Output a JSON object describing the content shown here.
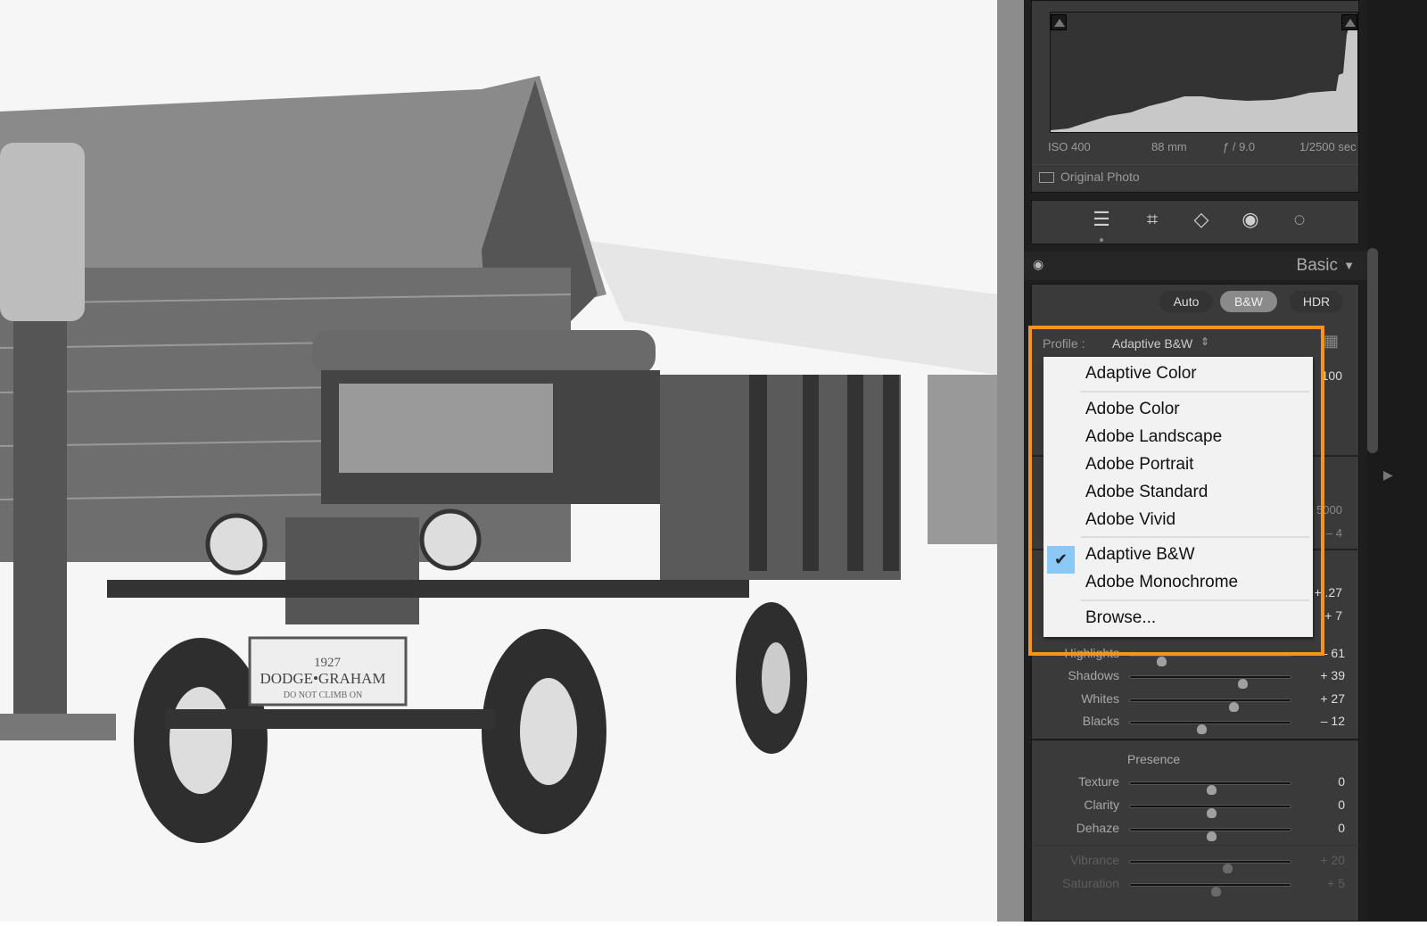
{
  "histogram": {
    "iso": "ISO 400",
    "focal": "88 mm",
    "aperture": "ƒ / 9.0",
    "shutter": "1/2500 sec",
    "original_photo_label": "Original Photo"
  },
  "tools": [
    "edit-sliders-icon",
    "crop-icon",
    "healing-eraser-icon",
    "red-eye-icon",
    "masking-icon"
  ],
  "basic": {
    "title": "Basic",
    "auto": "Auto",
    "bw": "B&W",
    "hdr": "HDR"
  },
  "profile": {
    "label": "Profile :",
    "value": "Adaptive B&W"
  },
  "profile_menu": {
    "items": [
      "Adaptive Color",
      "Adobe Color",
      "Adobe Landscape",
      "Adobe Portrait",
      "Adobe Standard",
      "Adobe Vivid",
      "Adaptive B&W",
      "Adobe Monochrome",
      "Browse..."
    ],
    "selected": "Adaptive B&W"
  },
  "hidden_values": {
    "amount": "100",
    "temp": "5000",
    "tint": "– 4",
    "exposure": "+ .27",
    "contrast": "+ 7"
  },
  "sliders": [
    {
      "label": "Highlights",
      "value": "– 61",
      "num": -61
    },
    {
      "label": "Shadows",
      "value": "+ 39",
      "num": 39
    },
    {
      "label": "Whites",
      "value": "+ 27",
      "num": 27
    },
    {
      "label": "Blacks",
      "value": "– 12",
      "num": -12
    }
  ],
  "presence": {
    "title": "Presence",
    "sliders": [
      {
        "label": "Texture",
        "value": "0",
        "num": 0
      },
      {
        "label": "Clarity",
        "value": "0",
        "num": 0
      },
      {
        "label": "Dehaze",
        "value": "0",
        "num": 0
      },
      {
        "label": "Vibrance",
        "value": "+ 20",
        "num": 20
      },
      {
        "label": "Saturation",
        "value": "+ 5",
        "num": 5
      }
    ]
  },
  "photo_sign": {
    "line1": "1927",
    "line2": "DODGE•GRAHAM",
    "line3": "DO NOT CLIMB ON"
  },
  "colors": {
    "accent": "#f7931e",
    "check_bg": "#8cc8f5",
    "panel": "#1f1f1f"
  }
}
